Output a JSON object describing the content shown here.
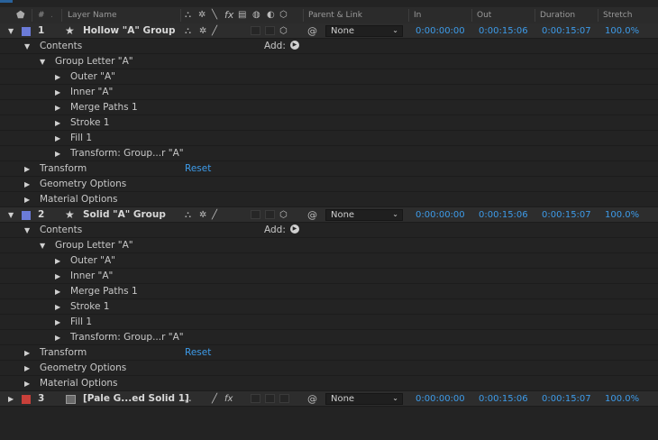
{
  "header": {
    "label_icon": "tag-icon",
    "num_label": "#",
    "layer_name_label": "Layer Name",
    "switch_icons": [
      "shy-icon",
      "collapse-icon",
      "quality-icon",
      "fx-icon",
      "frame-blend-icon",
      "motion-blur-icon",
      "adjustment-icon",
      "3d-icon"
    ],
    "parent_label": "Parent & Link",
    "in_label": "In",
    "out_label": "Out",
    "duration_label": "Duration",
    "stretch_label": "Stretch"
  },
  "layers": [
    {
      "num": "1",
      "name": "Hollow \"A\" Group",
      "label_color": "#6b7bd8",
      "parent": "None",
      "in": "0:00:00:00",
      "out": "0:00:15:06",
      "duration": "0:00:15:07",
      "stretch": "100.0%"
    },
    {
      "num": "2",
      "name": "Solid \"A\" Group",
      "label_color": "#6b7bd8",
      "parent": "None",
      "in": "0:00:00:00",
      "out": "0:00:15:06",
      "duration": "0:00:15:07",
      "stretch": "100.0%"
    },
    {
      "num": "3",
      "name": "[Pale G...ed Solid 1]",
      "label_color": "#c8403a",
      "parent": "None",
      "in": "0:00:00:00",
      "out": "0:00:15:06",
      "duration": "0:00:15:07",
      "stretch": "100.0%"
    }
  ],
  "props": {
    "contents": "Contents",
    "add": "Add:",
    "group_letter": "Group Letter \"A\"",
    "outer": "Outer \"A\"",
    "inner": "Inner \"A\"",
    "merge": "Merge Paths 1",
    "stroke": "Stroke 1",
    "fill": "Fill 1",
    "transform_group": "Transform: Group...r \"A\"",
    "transform": "Transform",
    "reset": "Reset",
    "geometry": "Geometry Options",
    "material": "Material Options"
  },
  "glyphs": {
    "expanded": "▼",
    "collapsed": "▶",
    "star": "★",
    "spiral": "@",
    "chevron": "⌄"
  }
}
